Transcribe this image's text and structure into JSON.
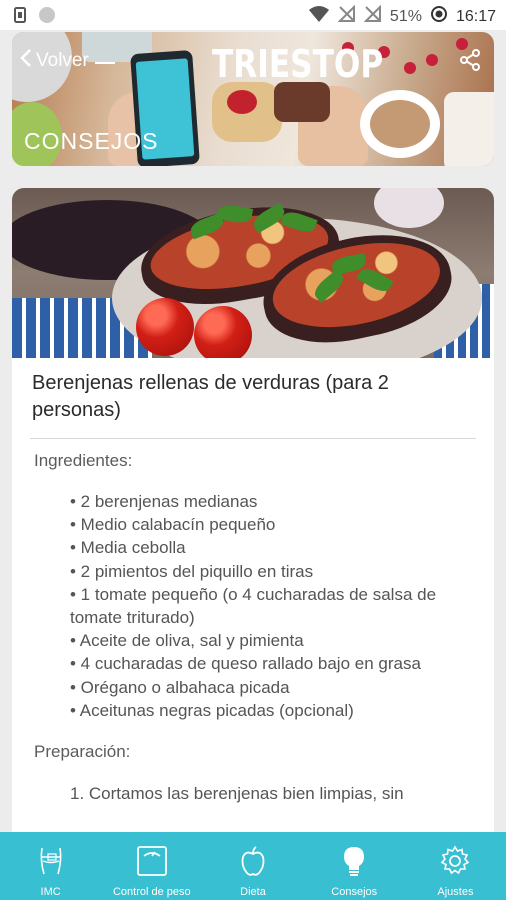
{
  "status_bar": {
    "battery_percent": "51%",
    "time": "16:17"
  },
  "header": {
    "back_label": "Volver",
    "brand": "TRIESTOP",
    "section_title": "CONSEJOS"
  },
  "recipe": {
    "title": "Berenjenas rellenas de verduras (para 2 personas)",
    "ingredients_heading": "Ingredientes:",
    "ingredients": [
      "• 2 berenjenas medianas",
      "• Medio calabacín pequeño",
      "• Media cebolla",
      "• 2 pimientos del piquillo en tiras",
      "• 1 tomate pequeño (o 4 cucharadas de salsa de tomate triturado)",
      "• Aceite de oliva, sal y pimienta",
      "• 4 cucharadas de queso rallado bajo en grasa",
      "• Orégano o albahaca picada",
      "• Aceitunas negras picadas (opcional)"
    ],
    "preparation_heading": "Preparación:",
    "preparation_step_1": "1. Cortamos las berenjenas bien limpias, sin"
  },
  "bottom_nav": {
    "items": [
      {
        "label": "IMC",
        "icon": "body-measure-icon"
      },
      {
        "label": "Control de peso",
        "icon": "scale-icon"
      },
      {
        "label": "Dieta",
        "icon": "apple-icon"
      },
      {
        "label": "Consejos",
        "icon": "lightbulb-icon"
      },
      {
        "label": "Ajustes",
        "icon": "gear-icon"
      }
    ]
  },
  "colors": {
    "accent": "#39bfd2",
    "background": "#ececec",
    "text": "#2b2b2b"
  }
}
